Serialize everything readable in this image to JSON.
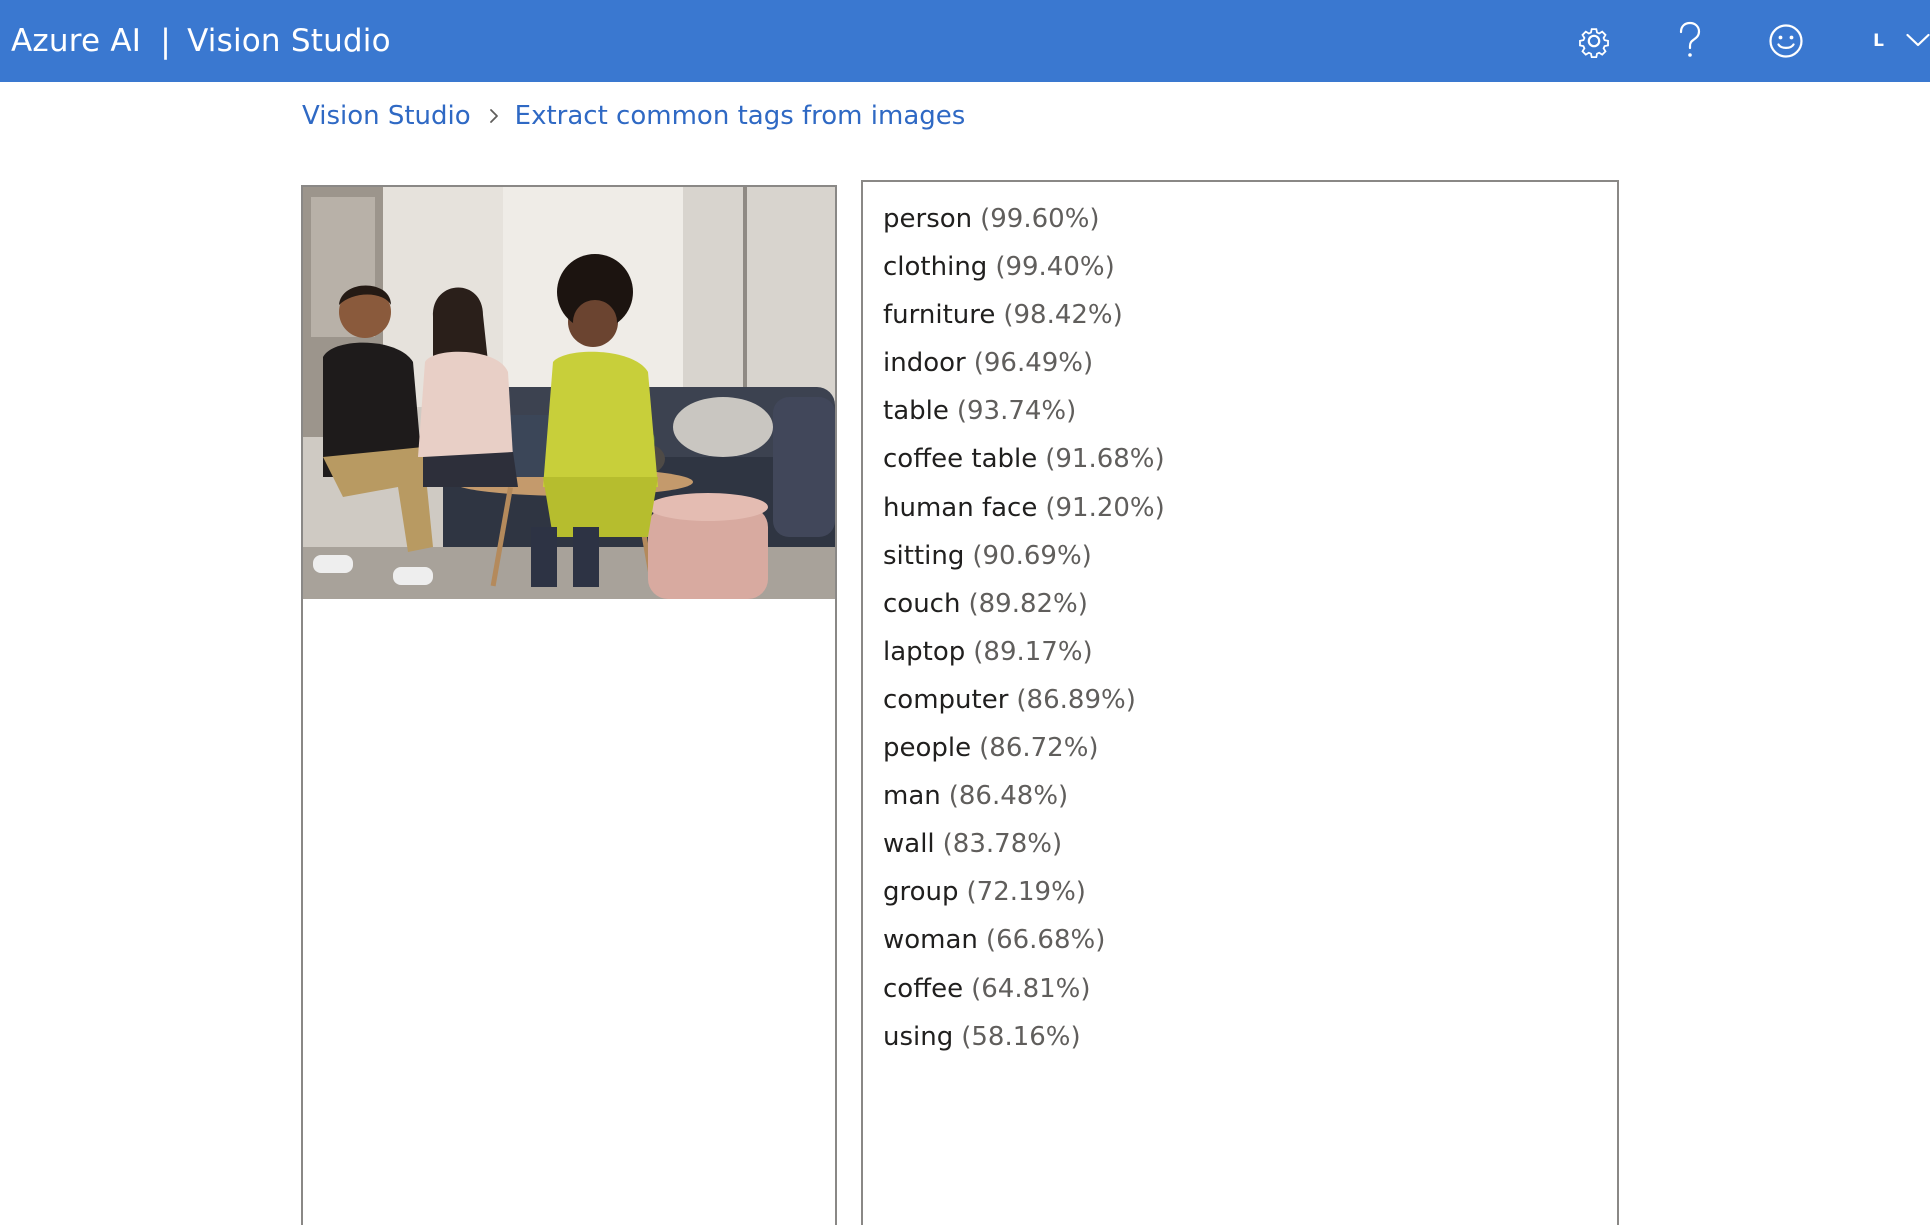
{
  "header": {
    "product": "Azure AI",
    "separator": "|",
    "app_name": "Vision Studio",
    "user_initial": "L",
    "icons": [
      "settings-icon",
      "help-icon",
      "feedback-icon",
      "chevron-down-icon"
    ]
  },
  "breadcrumb": {
    "root": "Vision Studio",
    "current": "Extract common tags from images"
  },
  "tags": [
    {
      "name": "person",
      "confidence": "(99.60%)"
    },
    {
      "name": "clothing",
      "confidence": "(99.40%)"
    },
    {
      "name": "furniture",
      "confidence": "(98.42%)"
    },
    {
      "name": "indoor",
      "confidence": "(96.49%)"
    },
    {
      "name": "table",
      "confidence": "(93.74%)"
    },
    {
      "name": "coffee table",
      "confidence": "(91.68%)"
    },
    {
      "name": "human face",
      "confidence": "(91.20%)"
    },
    {
      "name": "sitting",
      "confidence": "(90.69%)"
    },
    {
      "name": "couch",
      "confidence": "(89.82%)"
    },
    {
      "name": "laptop",
      "confidence": "(89.17%)"
    },
    {
      "name": "computer",
      "confidence": "(86.89%)"
    },
    {
      "name": "people",
      "confidence": "(86.72%)"
    },
    {
      "name": "man",
      "confidence": "(86.48%)"
    },
    {
      "name": "wall",
      "confidence": "(83.78%)"
    },
    {
      "name": "group",
      "confidence": "(72.19%)"
    },
    {
      "name": "woman",
      "confidence": "(66.68%)"
    },
    {
      "name": "coffee",
      "confidence": "(64.81%)"
    },
    {
      "name": "using",
      "confidence": "(58.16%)"
    }
  ],
  "colors": {
    "header_bg": "#3a78d0",
    "link": "#2f69c4",
    "panel_border": "#8a8886"
  }
}
